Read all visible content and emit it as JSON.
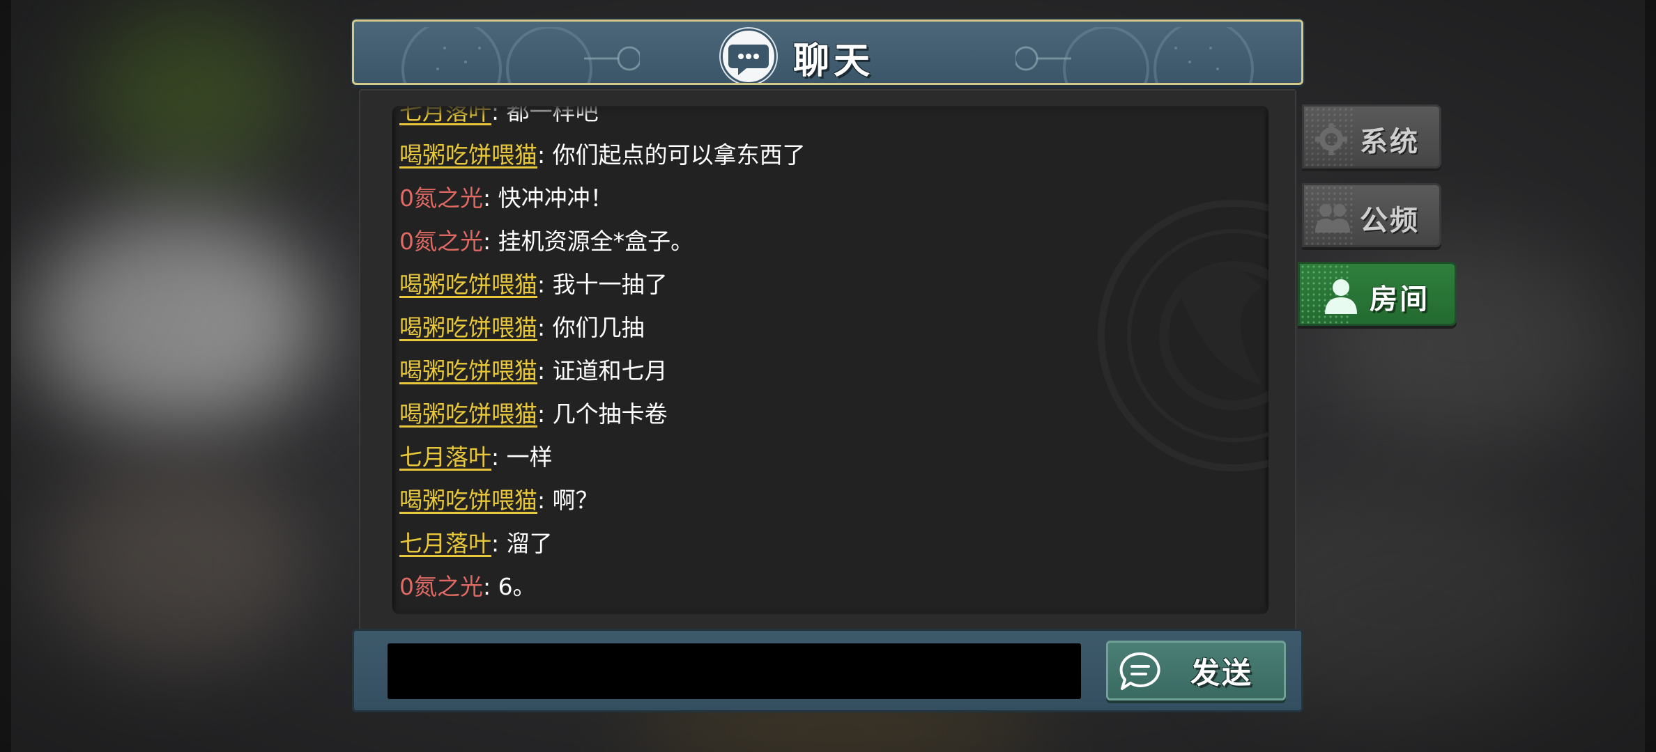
{
  "title": "聊天",
  "tabs": [
    {
      "label": "系统",
      "icon": "gear-icon",
      "active": false
    },
    {
      "label": "公频",
      "icon": "group-icon",
      "active": false
    },
    {
      "label": "房间",
      "icon": "user-icon",
      "active": true
    }
  ],
  "messages": [
    {
      "user": "七月落叶",
      "user_style": "yellow",
      "text": ": 都一样吧"
    },
    {
      "user": "喝粥吃饼喂猫",
      "user_style": "yellow",
      "text": ": 你们起点的可以拿东西了"
    },
    {
      "user": "0氮之光",
      "user_style": "red",
      "text": ": 快冲冲冲！"
    },
    {
      "user": "0氮之光",
      "user_style": "red",
      "text": ": 挂机资源全*盒子。"
    },
    {
      "user": "喝粥吃饼喂猫",
      "user_style": "yellow",
      "text": ": 我十一抽了"
    },
    {
      "user": "喝粥吃饼喂猫",
      "user_style": "yellow",
      "text": ": 你们几抽"
    },
    {
      "user": "喝粥吃饼喂猫",
      "user_style": "yellow",
      "text": ": 证道和七月"
    },
    {
      "user": "喝粥吃饼喂猫",
      "user_style": "yellow",
      "text": ": 几个抽卡卷"
    },
    {
      "user": "七月落叶",
      "user_style": "yellow",
      "text": ": 一样"
    },
    {
      "user": "喝粥吃饼喂猫",
      "user_style": "yellow",
      "text": ": 啊？"
    },
    {
      "user": "七月落叶",
      "user_style": "yellow",
      "text": ": 溜了"
    },
    {
      "user": "0氮之光",
      "user_style": "red",
      "text": ": 6。"
    }
  ],
  "input": {
    "value": "",
    "placeholder": ""
  },
  "send_button": {
    "label": "发送"
  },
  "colors": {
    "username_yellow": "#e8c83a",
    "username_red": "#e06a63",
    "active_tab": "#2f7f3c",
    "title_bar": "#4b6779"
  }
}
